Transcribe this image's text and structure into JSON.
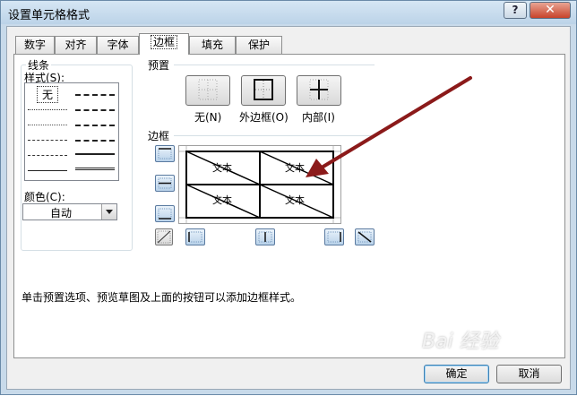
{
  "window": {
    "title": "设置单元格格式",
    "help_label": "?",
    "close_label": "✕"
  },
  "tabs": [
    {
      "label": "数字",
      "active": false
    },
    {
      "label": "对齐",
      "active": false
    },
    {
      "label": "字体",
      "active": false
    },
    {
      "label": "边框",
      "active": true
    },
    {
      "label": "填充",
      "active": false
    },
    {
      "label": "保护",
      "active": false
    }
  ],
  "line_group": {
    "title": "线条",
    "style_label": "样式(S):",
    "none_label": "无",
    "color_label": "颜色(C):",
    "color_value": "自动"
  },
  "presets": {
    "title": "预置",
    "items": [
      {
        "label": "无(N)",
        "icon": "preset-none-icon"
      },
      {
        "label": "外边框(O)",
        "icon": "preset-outline-icon"
      },
      {
        "label": "内部(I)",
        "icon": "preset-inside-icon"
      }
    ]
  },
  "border": {
    "title": "边框",
    "preview_cells": [
      "文本",
      "文本",
      "文本",
      "文本"
    ]
  },
  "hint": "单击预置选项、预览草图及上面的按钮可以添加边框样式。",
  "buttons": {
    "ok": "确定",
    "cancel": "取消"
  },
  "watermark": "Bai 经验",
  "colors": {
    "accent_arrow": "#8b1a1a",
    "title_bar": "#c8daea",
    "close": "#c8432a"
  }
}
